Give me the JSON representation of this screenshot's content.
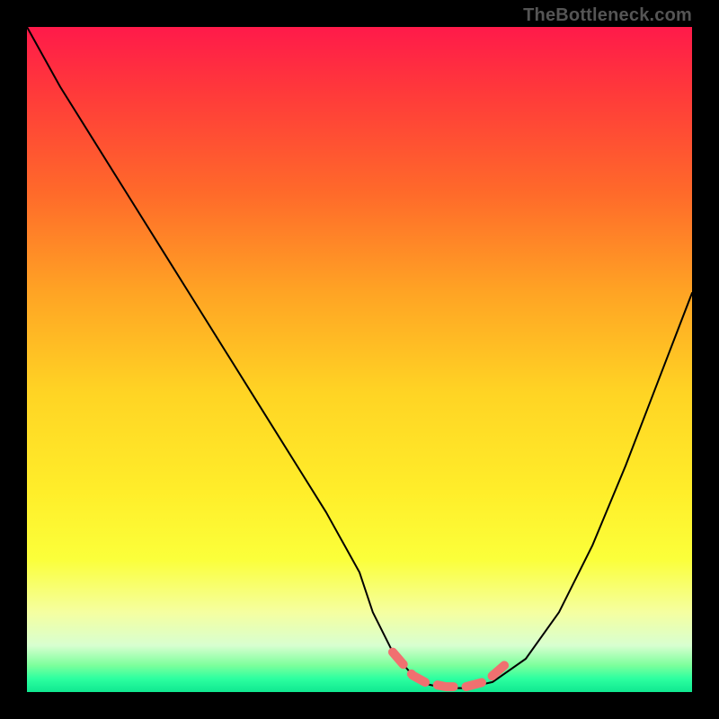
{
  "watermark": "TheBottleneck.com",
  "chart_data": {
    "type": "line",
    "title": "",
    "xlabel": "",
    "ylabel": "",
    "xlim": [
      0,
      100
    ],
    "ylim": [
      0,
      100
    ],
    "grid": false,
    "legend": false,
    "series": [
      {
        "name": "bottleneck-curve",
        "x": [
          0,
          5,
          10,
          15,
          20,
          25,
          30,
          35,
          40,
          45,
          50,
          52,
          55,
          58,
          60,
          63,
          66,
          70,
          75,
          80,
          85,
          90,
          95,
          100
        ],
        "y": [
          100,
          91,
          83,
          75,
          67,
          59,
          51,
          43,
          35,
          27,
          18,
          12,
          6,
          2.5,
          1.2,
          0.6,
          0.6,
          1.5,
          5,
          12,
          22,
          34,
          47,
          60
        ]
      },
      {
        "name": "optimal-range-marker",
        "x": [
          55,
          58,
          60,
          63,
          66,
          69,
          72
        ],
        "y": [
          6,
          2.5,
          1.4,
          0.8,
          0.8,
          1.6,
          4.2
        ]
      }
    ]
  }
}
